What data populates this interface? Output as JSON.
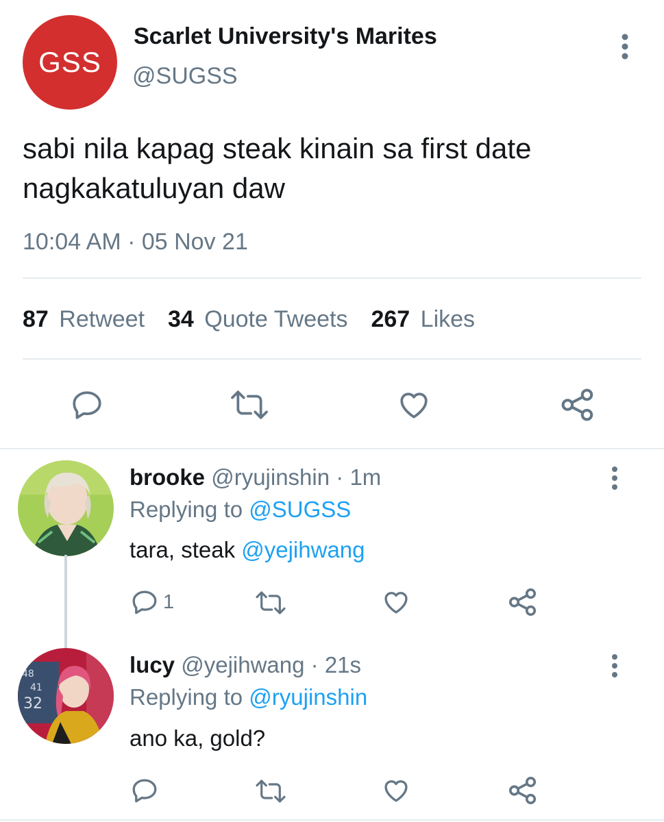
{
  "tweet": {
    "avatar_text": "GSS",
    "name": "Scarlet University's Marites",
    "handle": "@SUGSS",
    "text_line1": "sabi nila kapag steak kinain sa first date",
    "text_line2": "nagkakatuluyan daw",
    "timestamp": "10:04 AM · 05 Nov 21",
    "stats": {
      "retweets_count": "87",
      "retweets_label": "Retweet",
      "quotes_count": "34",
      "quotes_label": "Quote Tweets",
      "likes_count": "267",
      "likes_label": "Likes"
    }
  },
  "replies": [
    {
      "name": "brooke",
      "handle": "@ryujinshin",
      "time": "· 1m",
      "replying_prefix": "Replying to",
      "replying_to": "@SUGSS",
      "text": "tara, steak",
      "mention": "@yejihwang",
      "reply_count": "1"
    },
    {
      "name": "lucy",
      "handle": "@yejihwang",
      "time": "· 21s",
      "replying_prefix": "Replying to",
      "replying_to": "@ryujinshin",
      "text": "ano ka, gold?",
      "avatar_overlay_text": [
        "48",
        "41",
        "32"
      ]
    }
  ],
  "colors": {
    "brand_red": "#d32f2f",
    "link_blue": "#1da1f2",
    "muted_gray": "#657786",
    "icon_gray": "#657786"
  },
  "icons": [
    "more-vertical-icon",
    "reply-icon",
    "retweet-icon",
    "like-icon",
    "share-icon"
  ]
}
